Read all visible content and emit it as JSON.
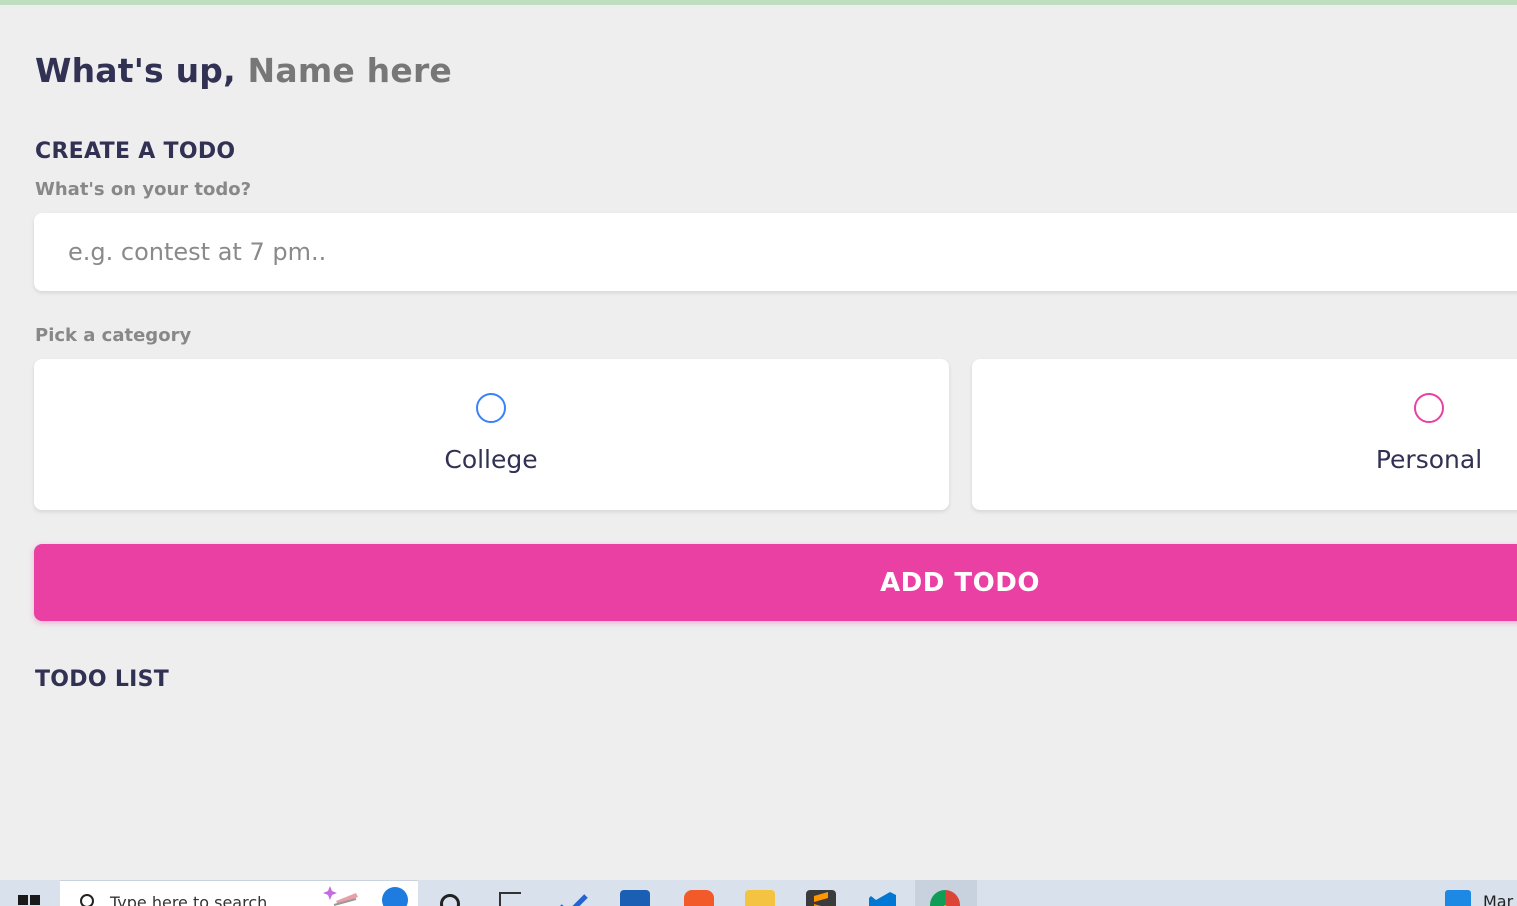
{
  "greeting": {
    "prefix": "What's up,",
    "name": "Name here"
  },
  "create": {
    "title": "CREATE A TODO",
    "input_label": "What's on your todo?",
    "input_placeholder": "e.g. contest at 7 pm..",
    "input_value": "",
    "category_label": "Pick a category",
    "categories": [
      {
        "label": "College",
        "selected": false,
        "color": "#3A82F7"
      },
      {
        "label": "Personal",
        "selected": false,
        "color": "#EA40A4"
      }
    ],
    "add_button_label": "ADD TODO"
  },
  "list": {
    "title": "TODO LIST",
    "items": []
  },
  "taskbar": {
    "search_placeholder": "Type here to search",
    "right_text": "Mar",
    "icons": [
      "windows-start-icon",
      "search-icon",
      "task-view-icon",
      "todo-app-icon",
      "mail-icon",
      "brave-browser-icon",
      "file-explorer-icon",
      "sublime-text-icon",
      "vscode-icon",
      "chrome-icon",
      "app-icon"
    ]
  },
  "colors": {
    "accent": "#EA40A4",
    "college": "#3A82F7",
    "text_dark": "#313154",
    "background": "#EEEEEE"
  }
}
